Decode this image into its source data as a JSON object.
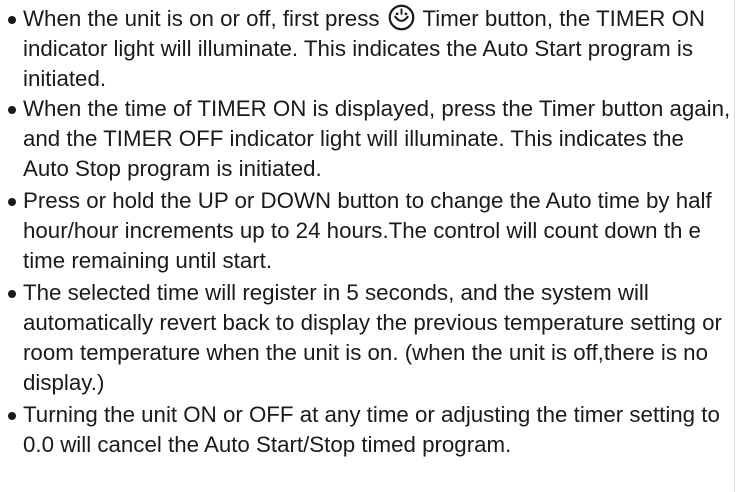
{
  "items": [
    {
      "segments": [
        "When the unit is on or off, first press ",
        " Timer button, the TIMER ON indicator light will illuminate. This indicates the Auto Start program is initiated."
      ],
      "icon": "timer-icon"
    },
    {
      "text": "When the time of TIMER ON is displayed, press the Timer button again, and the TIMER OFF indicator light will illuminate. This indicates the Auto Stop program is initiated."
    },
    {
      "text": "Press or hold the UP or DOWN button to change the Auto time by half hour/hour increments up to 24 hours.The control will count down th e time remaining until start."
    },
    {
      "text": "The selected time will register in 5 seconds, and the system will automatically revert back to display the previous temperature setting or room temperature when the unit is on. (when the unit is off,there is no display.)"
    },
    {
      "text": "Turning the unit ON or OFF at any time or adjusting the timer setting to 0.0 will cancel the Auto Start/Stop timed program."
    }
  ]
}
